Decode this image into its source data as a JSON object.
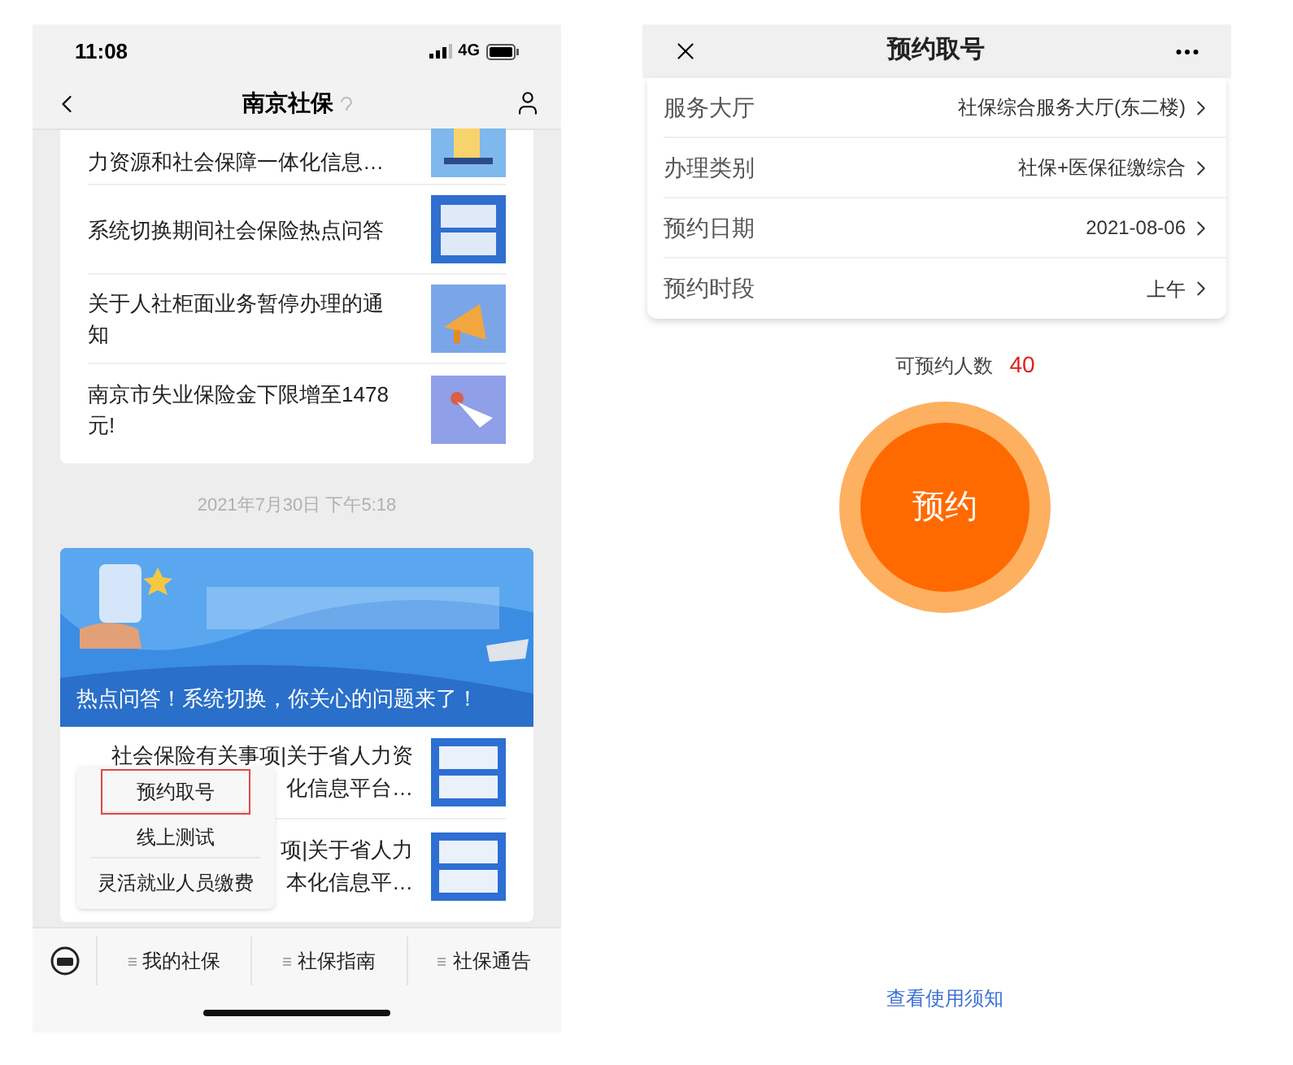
{
  "chat": {
    "status_bar": {
      "time": "11:08",
      "network": "4G"
    },
    "nav": {
      "title": "南京社保"
    },
    "articles": [
      {
        "title": "力资源和社会保障一体化信息…"
      },
      {
        "title": "系统切换期间社会保险热点问答"
      },
      {
        "title": "关于人社柜面业务暂停办理的通知"
      },
      {
        "title": "南京市失业保险金下限增至1478元!"
      }
    ],
    "timestamp": "2021年7月30日 下午5:18",
    "banner_caption": "热点问答！系统切换，你关心的问题来了！",
    "notice_rows": [
      {
        "lines": [
          "社会保险有关事项|关于省人力资",
          "化信息平台…"
        ]
      },
      {
        "lines": [
          "项|关于省人力",
          "本化信息平…"
        ]
      }
    ],
    "popup_menu": [
      {
        "label": "预约取号",
        "selected": true
      },
      {
        "label": "线上测试",
        "selected": false
      },
      {
        "label": "灵活就业人员缴费",
        "selected": false
      }
    ],
    "menu_bar": [
      {
        "label": "我的社保"
      },
      {
        "label": "社保指南"
      },
      {
        "label": "社保通告"
      }
    ]
  },
  "booking": {
    "title": "预约取号",
    "fields": [
      {
        "label": "服务大厅",
        "value": "社保综合服务大厅(东二楼)"
      },
      {
        "label": "办理类别",
        "value": "社保+医保征缴综合"
      },
      {
        "label": "预约日期",
        "value": "2021-08-06"
      },
      {
        "label": "预约时段",
        "value": "上午"
      }
    ],
    "quota_label": "可预约人数",
    "quota": "40",
    "button": "预约",
    "notice_link": "查看使用须知"
  }
}
